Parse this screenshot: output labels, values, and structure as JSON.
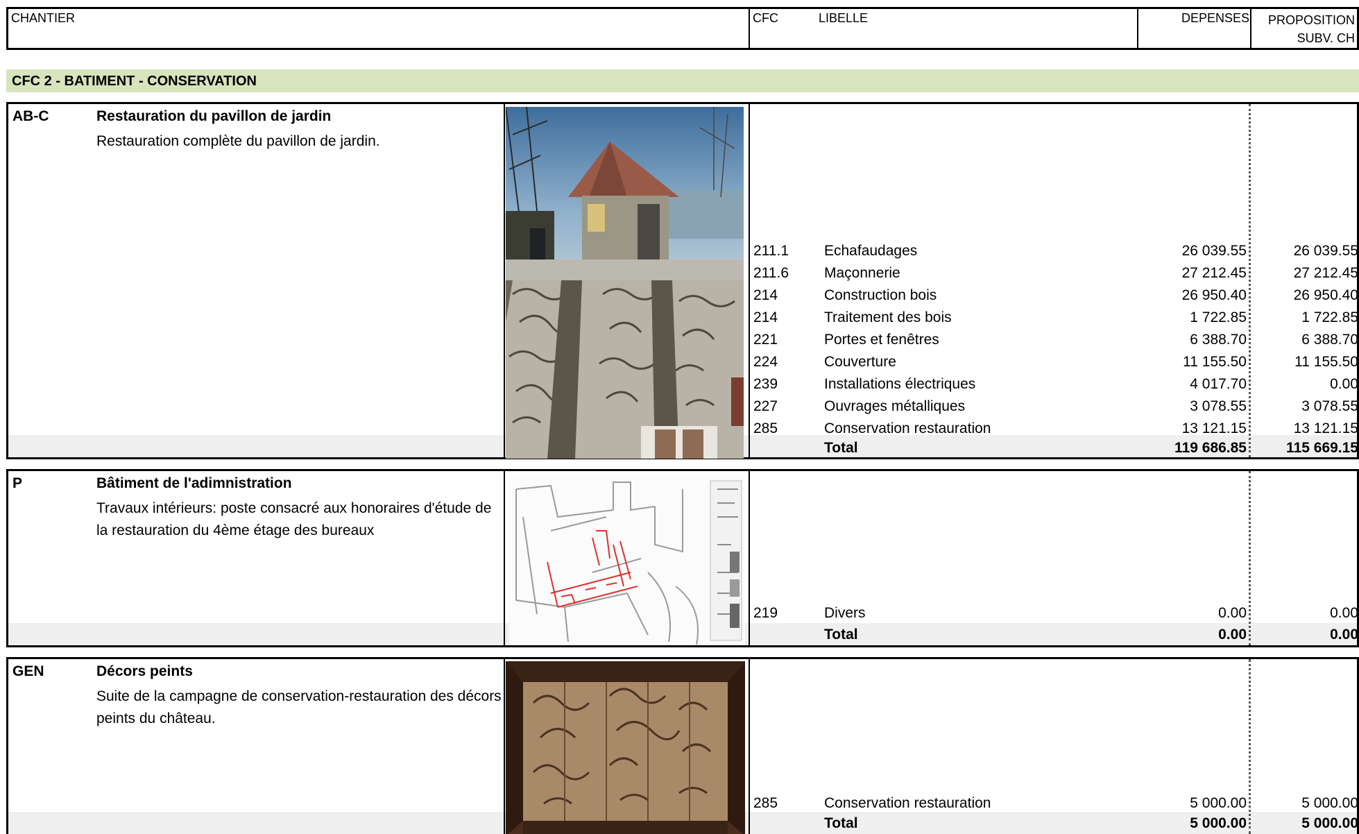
{
  "header": {
    "chantier": "CHANTIER",
    "cfc": "CFC",
    "libelle": "LIBELLE",
    "depenses": "DEPENSES",
    "proposition_line1": "PROPOSITION",
    "proposition_line2": "SUBV. CH"
  },
  "section": {
    "title": "CFC 2 - BATIMENT - CONSERVATION"
  },
  "blocks": [
    {
      "code": "AB-C",
      "title": "Restauration du pavillon de jardin",
      "description": "Restauration complète du pavillon de jardin.",
      "lines": [
        {
          "cfc": "211.1",
          "libelle": "Echafaudages",
          "depenses": "26 039.55",
          "proposition": "26 039.55"
        },
        {
          "cfc": "211.6",
          "libelle": "Maçonnerie",
          "depenses": "27 212.45",
          "proposition": "27 212.45"
        },
        {
          "cfc": "214",
          "libelle": "Construction bois",
          "depenses": "26 950.40",
          "proposition": "26 950.40"
        },
        {
          "cfc": "214",
          "libelle": "Traitement des bois",
          "depenses": "1 722.85",
          "proposition": "1 722.85"
        },
        {
          "cfc": "221",
          "libelle": "Portes et fenêtres",
          "depenses": "6 388.70",
          "proposition": "6 388.70"
        },
        {
          "cfc": "224",
          "libelle": "Couverture",
          "depenses": "11 155.50",
          "proposition": "11 155.50"
        },
        {
          "cfc": "239",
          "libelle": "Installations électriques",
          "depenses": "4 017.70",
          "proposition": "0.00"
        },
        {
          "cfc": "227",
          "libelle": "Ouvrages métalliques",
          "depenses": "3 078.55",
          "proposition": "3 078.55"
        },
        {
          "cfc": "285",
          "libelle": "Conservation restauration",
          "depenses": "13 121.15",
          "proposition": "13 121.15"
        }
      ],
      "total": {
        "libelle": "Total",
        "depenses": "119 686.85",
        "proposition": "115 669.15"
      }
    },
    {
      "code": "P",
      "title": "Bâtiment de l'adimnistration",
      "description": "Travaux intérieurs: poste consacré aux honoraires d'étude de la restauration du 4ème étage des bureaux",
      "lines": [
        {
          "cfc": "219",
          "libelle": "Divers",
          "depenses": "0.00",
          "proposition": "0.00"
        }
      ],
      "total": {
        "libelle": "Total",
        "depenses": "0.00",
        "proposition": "0.00"
      }
    },
    {
      "code": "GEN",
      "title": "Décors peints",
      "description": "Suite de la campagne de conservation-restauration des décors peints du château.",
      "lines": [
        {
          "cfc": "285",
          "libelle": "Conservation restauration",
          "depenses": "5 000.00",
          "proposition": "5 000.00"
        }
      ],
      "total": {
        "libelle": "Total",
        "depenses": "5 000.00",
        "proposition": "5 000.00"
      }
    }
  ],
  "colors": {
    "band": "#d8e4bc",
    "total_row": "#efefef",
    "red_plan": "#e03030"
  }
}
